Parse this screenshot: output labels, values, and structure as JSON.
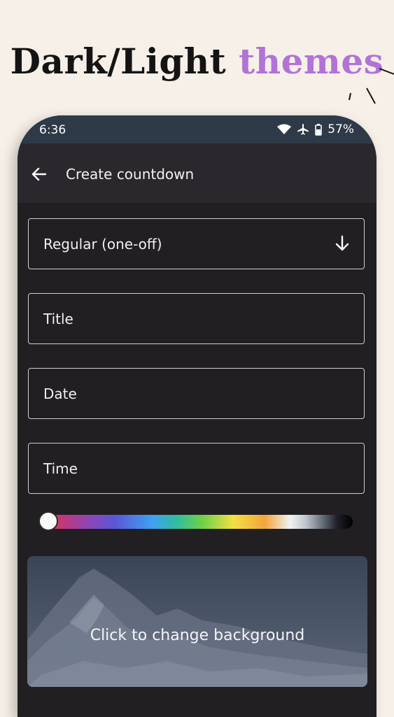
{
  "headline": {
    "part1": "Dark/Light",
    "part2": "themes"
  },
  "status_bar": {
    "time": "6:36",
    "battery": "57%"
  },
  "app_bar": {
    "title": "Create countdown"
  },
  "form": {
    "type_select": "Regular (one-off)",
    "title_label": "Title",
    "date_label": "Date",
    "time_label": "Time"
  },
  "background": {
    "caption": "Click to change background"
  },
  "colors": {
    "accent": "#b173d6",
    "page_bg": "#f7f0e8",
    "app_bg": "#211f21",
    "status_bar": "#2e3a48"
  }
}
